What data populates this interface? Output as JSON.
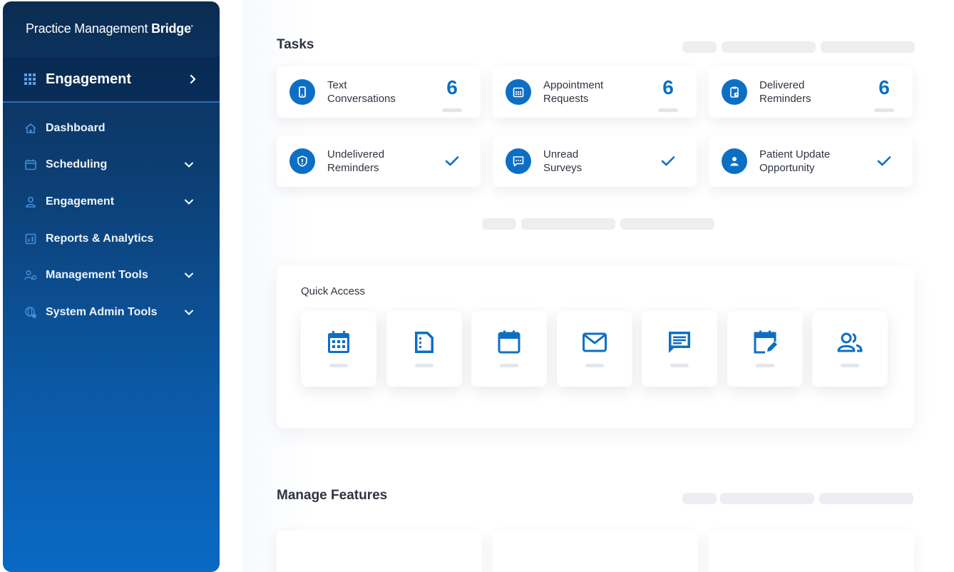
{
  "sidebar": {
    "brand_regular": "Practice Management",
    "brand_bold": "Bridge",
    "brand_mark": "•",
    "section": "Engagement",
    "items": [
      {
        "label": "Dashboard",
        "icon": "home-icon",
        "expandable": false
      },
      {
        "label": "Scheduling",
        "icon": "calendar-icon",
        "expandable": true
      },
      {
        "label": "Engagement",
        "icon": "user-icon",
        "expandable": true
      },
      {
        "label": "Reports & Analytics",
        "icon": "report-icon",
        "expandable": false
      },
      {
        "label": "Management Tools",
        "icon": "users-cog-icon",
        "expandable": true
      },
      {
        "label": "System Admin Tools",
        "icon": "admin-globe-icon",
        "expandable": true
      }
    ]
  },
  "tasks": {
    "title": "Tasks",
    "cards": [
      {
        "label_1": "Text",
        "label_2": "Conversations",
        "count": "6",
        "icon": "phone-icon"
      },
      {
        "label_1": "Appointment",
        "label_2": "Requests",
        "count": "6",
        "icon": "calendar-grid-icon"
      },
      {
        "label_1": "Delivered",
        "label_2": "Reminders",
        "count": "6",
        "icon": "clipboard-clock-icon"
      },
      {
        "label_1": "Undelivered",
        "label_2": "Reminders",
        "status": "check",
        "icon": "shield-alert-icon"
      },
      {
        "label_1": "Unread",
        "label_2": "Surveys",
        "status": "check",
        "icon": "chat-dots-icon"
      },
      {
        "label_1": "Patient Update",
        "label_2": "Opportunity",
        "status": "check",
        "icon": "person-badge-icon"
      }
    ]
  },
  "quick_access": {
    "title": "Quick Access",
    "tiles": [
      {
        "icon": "calendar-grid-icon"
      },
      {
        "icon": "document-icon"
      },
      {
        "icon": "calendar-icon"
      },
      {
        "icon": "mail-icon"
      },
      {
        "icon": "message-icon"
      },
      {
        "icon": "calendar-edit-icon"
      },
      {
        "icon": "users-icon"
      }
    ]
  },
  "manage_features": {
    "title": "Manage Features"
  },
  "colors": {
    "accent": "#0d6fc4",
    "sidebar_top": "#0b2c52",
    "sidebar_bottom": "#0a69c4",
    "text": "#2f3540"
  }
}
